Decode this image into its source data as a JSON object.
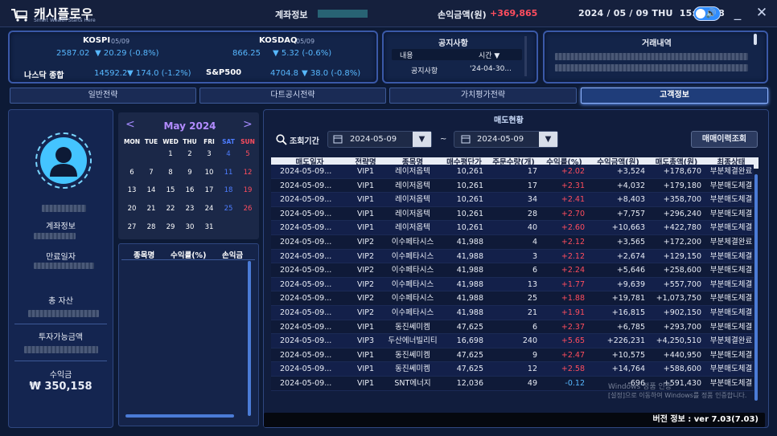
{
  "app": {
    "title": "캐시플로우",
    "subtitle": "Smart Wealth Starts Here"
  },
  "topbar": {
    "account_label": "계좌정보",
    "profit_label": "손익금액(원)",
    "profit_value": "+369,865",
    "date": "2024 / 05 / 09 THU",
    "time": "15:22:18"
  },
  "indices": {
    "kospi": {
      "name": "KOSPI",
      "date": "05/09",
      "value": "2587.02",
      "change": "20.29 (-0.8%)"
    },
    "kosdaq": {
      "name": "KOSDAQ",
      "date": "05/09",
      "value": "866.25",
      "change": "5.32 (-0.6%)"
    },
    "nasdaq": {
      "name": "나스닥 종합",
      "value": "14592.2",
      "change": "174.0 (-1.2%)"
    },
    "sp500": {
      "name": "S&P500",
      "value": "4704.8",
      "change": "38.0 (-0.8%)"
    }
  },
  "notice": {
    "title": "공지사항",
    "col_content": "내용",
    "col_time": "시간",
    "row_content": "공지사항",
    "row_time": "'24-04-30..."
  },
  "trade_history": {
    "title": "거래내역"
  },
  "tabs": [
    "일반전략",
    "다트공시전략",
    "가치평가전략",
    "고객정보"
  ],
  "left": {
    "account_label": "계좌정보",
    "expire_label": "만료일자",
    "total_label": "총 자산",
    "invest_label": "투자가능금액",
    "profit_label": "수익금",
    "profit_value": "₩ 350,158"
  },
  "calendar": {
    "title": "May 2024",
    "dow": [
      "MON",
      "TUE",
      "WED",
      "THU",
      "FRI",
      "SAT",
      "SUN"
    ],
    "weeks": [
      [
        "",
        "",
        "1",
        "2",
        "3",
        "4",
        "5"
      ],
      [
        "6",
        "7",
        "8",
        "9",
        "10",
        "11",
        "12"
      ],
      [
        "13",
        "14",
        "15",
        "16",
        "17",
        "18",
        "19"
      ],
      [
        "20",
        "21",
        "22",
        "23",
        "24",
        "25",
        "26"
      ],
      [
        "27",
        "28",
        "29",
        "30",
        "31",
        "",
        ""
      ]
    ]
  },
  "mini_table": {
    "headers": [
      "종목명",
      "수익률(%)",
      "손익금"
    ]
  },
  "sales": {
    "title": "매도현황",
    "period_label": "조회기간",
    "date_from": "2024-05-09",
    "date_to": "2024-05-09",
    "tilde": "~",
    "history_btn": "매매이력조회",
    "headers": [
      "매도일자",
      "전략명",
      "종목명",
      "매수평단가",
      "주문수량(개)",
      "수익률(%)",
      "수익금액(원)",
      "매도총액(원)",
      "최종상태"
    ],
    "rows": [
      [
        "2024-05-09...",
        "VIP1",
        "레이저옵텍",
        "10,261",
        "17",
        "+2.02",
        "+3,524",
        "+178,670",
        "부분체결완료"
      ],
      [
        "2024-05-09...",
        "VIP1",
        "레이저옵텍",
        "10,261",
        "17",
        "+2.31",
        "+4,032",
        "+179,180",
        "부분매도체결"
      ],
      [
        "2024-05-09...",
        "VIP1",
        "레이저옵텍",
        "10,261",
        "34",
        "+2.41",
        "+8,403",
        "+358,700",
        "부분매도체결"
      ],
      [
        "2024-05-09...",
        "VIP1",
        "레이저옵텍",
        "10,261",
        "28",
        "+2.70",
        "+7,757",
        "+296,240",
        "부분매도체결"
      ],
      [
        "2024-05-09...",
        "VIP1",
        "레이저옵텍",
        "10,261",
        "40",
        "+2.60",
        "+10,663",
        "+422,780",
        "부분매도체결"
      ],
      [
        "2024-05-09...",
        "VIP2",
        "이수페타시스",
        "41,988",
        "4",
        "+2.12",
        "+3,565",
        "+172,200",
        "부분체결완료"
      ],
      [
        "2024-05-09...",
        "VIP2",
        "이수페타시스",
        "41,988",
        "3",
        "+2.12",
        "+2,674",
        "+129,150",
        "부분매도체결"
      ],
      [
        "2024-05-09...",
        "VIP2",
        "이수페타시스",
        "41,988",
        "6",
        "+2.24",
        "+5,646",
        "+258,600",
        "부분매도체결"
      ],
      [
        "2024-05-09...",
        "VIP2",
        "이수페타시스",
        "41,988",
        "13",
        "+1.77",
        "+9,639",
        "+557,700",
        "부분매도체결"
      ],
      [
        "2024-05-09...",
        "VIP2",
        "이수페타시스",
        "41,988",
        "25",
        "+1.88",
        "+19,781",
        "+1,073,750",
        "부분매도체결"
      ],
      [
        "2024-05-09...",
        "VIP2",
        "이수페타시스",
        "41,988",
        "21",
        "+1.91",
        "+16,815",
        "+902,150",
        "부분매도체결"
      ],
      [
        "2024-05-09...",
        "VIP1",
        "동진쎄미켐",
        "47,625",
        "6",
        "+2.37",
        "+6,785",
        "+293,700",
        "부분매도체결"
      ],
      [
        "2024-05-09...",
        "VIP3",
        "두산에너빌리티",
        "16,698",
        "240",
        "+5.65",
        "+226,231",
        "+4,250,510",
        "부분체결완료"
      ],
      [
        "2024-05-09...",
        "VIP1",
        "동진쎄미켐",
        "47,625",
        "9",
        "+2.47",
        "+10,575",
        "+440,950",
        "부분매도체결"
      ],
      [
        "2024-05-09...",
        "VIP1",
        "동진쎄미켐",
        "47,625",
        "12",
        "+2.58",
        "+14,764",
        "+588,600",
        "부분매도체결"
      ],
      [
        "2024-05-09...",
        "VIP1",
        "SNT에너지",
        "12,036",
        "49",
        "-0.12",
        "-696",
        "+591,430",
        "부분매도체결"
      ]
    ]
  },
  "watermark": {
    "line1": "Windows 정품 인증",
    "line2": "[설정]으로 이동하여 Windows를 정품 인증합니다."
  },
  "version": "버전 정보 : ver 7.03(7.03)"
}
